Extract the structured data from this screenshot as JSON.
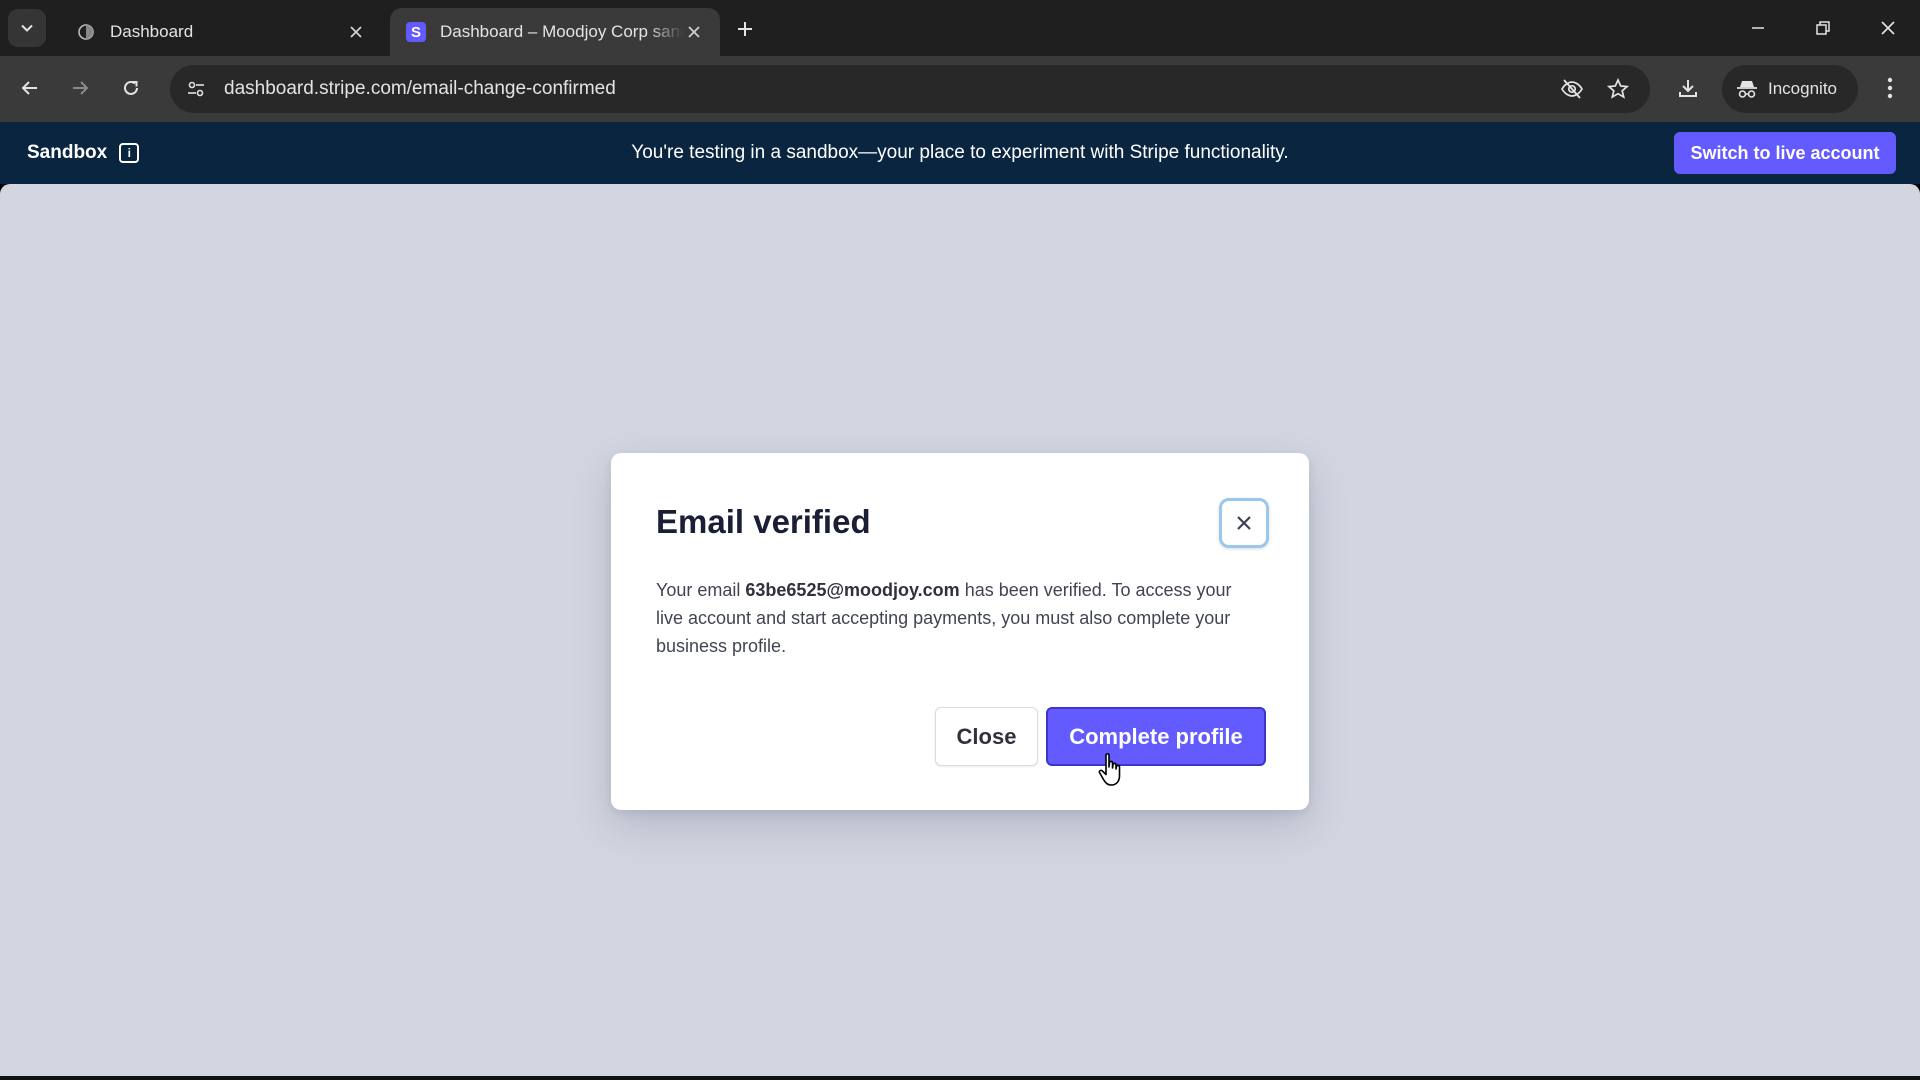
{
  "browser": {
    "tabs": [
      {
        "title": "Dashboard",
        "active": false
      },
      {
        "title": "Dashboard – Moodjoy Corp sandbox",
        "active": true
      }
    ],
    "url": "dashboard.stripe.com/email-change-confirmed",
    "incognito_label": "Incognito"
  },
  "banner": {
    "brand": "Sandbox",
    "info_glyph": "i",
    "message": "You're testing in a sandbox—your place to experiment with Stripe functionality.",
    "switch_button": "Switch to live account"
  },
  "modal": {
    "title": "Email verified",
    "body_prefix": "Your email ",
    "email": "63be6525@moodjoy.com",
    "body_suffix": " has been verified. To access your live account and start accepting payments, you must also complete your business profile.",
    "close_button": "Close",
    "primary_button": "Complete profile"
  },
  "colors": {
    "banner_bg": "#0a2540",
    "accent": "#635bff",
    "overlay": "#d2d6e0"
  }
}
